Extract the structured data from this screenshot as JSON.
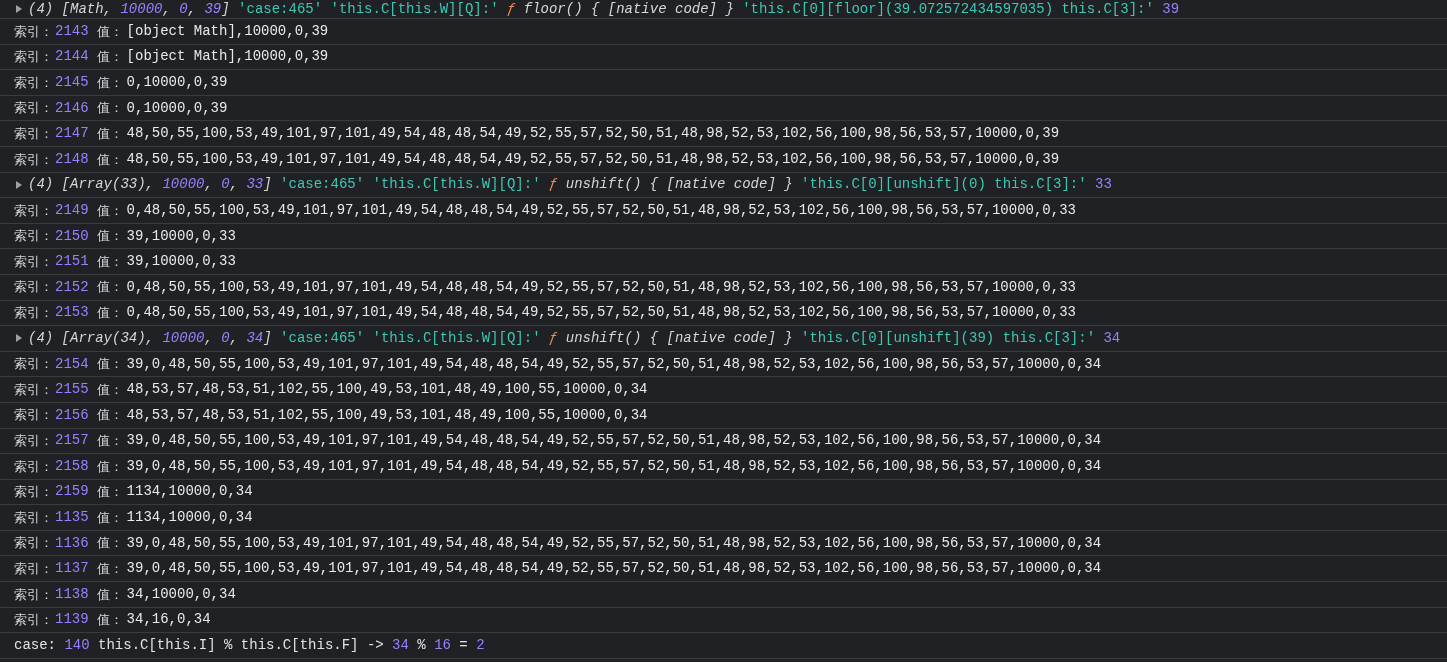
{
  "console": {
    "messages": [
      {
        "kind": "object",
        "expanded": false,
        "tokens": [
          {
            "kind": "preview",
            "text": "(4) [Math, "
          },
          {
            "kind": "preview_number",
            "text": "10000"
          },
          {
            "kind": "preview",
            "text": ", "
          },
          {
            "kind": "preview_number",
            "text": "0"
          },
          {
            "kind": "preview",
            "text": ", "
          },
          {
            "kind": "preview_number",
            "text": "39"
          },
          {
            "kind": "preview",
            "text": "]"
          },
          {
            "kind": "string",
            "text": " 'case:465' 'this.C[this.W][Q]:' "
          },
          {
            "kind": "function_sign",
            "text": "ƒ "
          },
          {
            "kind": "preview",
            "text": "floor() { [native code] }"
          },
          {
            "kind": "string",
            "text": " 'this.C[0][floor](39.072572434597035) this.C[3]:' "
          },
          {
            "kind": "number",
            "text": "39"
          }
        ]
      },
      {
        "kind": "index",
        "label": "索引：",
        "index": "2143",
        "value_label": "值：",
        "value": "[object Math],10000,0,39"
      },
      {
        "kind": "index",
        "label": "索引：",
        "index": "2144",
        "value_label": "值：",
        "value": "[object Math],10000,0,39"
      },
      {
        "kind": "index",
        "label": "索引：",
        "index": "2145",
        "value_label": "值：",
        "value": "0,10000,0,39"
      },
      {
        "kind": "index",
        "label": "索引：",
        "index": "2146",
        "value_label": "值：",
        "value": "0,10000,0,39"
      },
      {
        "kind": "index",
        "label": "索引：",
        "index": "2147",
        "value_label": "值：",
        "value": "48,50,55,100,53,49,101,97,101,49,54,48,48,54,49,52,55,57,52,50,51,48,98,52,53,102,56,100,98,56,53,57,10000,0,39"
      },
      {
        "kind": "index",
        "label": "索引：",
        "index": "2148",
        "value_label": "值：",
        "value": "48,50,55,100,53,49,101,97,101,49,54,48,48,54,49,52,55,57,52,50,51,48,98,52,53,102,56,100,98,56,53,57,10000,0,39"
      },
      {
        "kind": "object",
        "expanded": false,
        "tokens": [
          {
            "kind": "preview",
            "text": "(4) [Array(33), "
          },
          {
            "kind": "preview_number",
            "text": "10000"
          },
          {
            "kind": "preview",
            "text": ", "
          },
          {
            "kind": "preview_number",
            "text": "0"
          },
          {
            "kind": "preview",
            "text": ", "
          },
          {
            "kind": "preview_number",
            "text": "33"
          },
          {
            "kind": "preview",
            "text": "]"
          },
          {
            "kind": "string",
            "text": " 'case:465' 'this.C[this.W][Q]:' "
          },
          {
            "kind": "function_sign",
            "text": "ƒ "
          },
          {
            "kind": "preview",
            "text": "unshift() { [native code] }"
          },
          {
            "kind": "string",
            "text": " 'this.C[0][unshift](0) this.C[3]:' "
          },
          {
            "kind": "number",
            "text": "33"
          }
        ]
      },
      {
        "kind": "index",
        "label": "索引：",
        "index": "2149",
        "value_label": "值：",
        "value": "0,48,50,55,100,53,49,101,97,101,49,54,48,48,54,49,52,55,57,52,50,51,48,98,52,53,102,56,100,98,56,53,57,10000,0,33"
      },
      {
        "kind": "index",
        "label": "索引：",
        "index": "2150",
        "value_label": "值：",
        "value": "39,10000,0,33"
      },
      {
        "kind": "index",
        "label": "索引：",
        "index": "2151",
        "value_label": "值：",
        "value": "39,10000,0,33"
      },
      {
        "kind": "index",
        "label": "索引：",
        "index": "2152",
        "value_label": "值：",
        "value": "0,48,50,55,100,53,49,101,97,101,49,54,48,48,54,49,52,55,57,52,50,51,48,98,52,53,102,56,100,98,56,53,57,10000,0,33"
      },
      {
        "kind": "index",
        "label": "索引：",
        "index": "2153",
        "value_label": "值：",
        "value": "0,48,50,55,100,53,49,101,97,101,49,54,48,48,54,49,52,55,57,52,50,51,48,98,52,53,102,56,100,98,56,53,57,10000,0,33"
      },
      {
        "kind": "object",
        "expanded": false,
        "tokens": [
          {
            "kind": "preview",
            "text": "(4) [Array(34), "
          },
          {
            "kind": "preview_number",
            "text": "10000"
          },
          {
            "kind": "preview",
            "text": ", "
          },
          {
            "kind": "preview_number",
            "text": "0"
          },
          {
            "kind": "preview",
            "text": ", "
          },
          {
            "kind": "preview_number",
            "text": "34"
          },
          {
            "kind": "preview",
            "text": "]"
          },
          {
            "kind": "string",
            "text": " 'case:465' 'this.C[this.W][Q]:' "
          },
          {
            "kind": "function_sign",
            "text": "ƒ "
          },
          {
            "kind": "preview",
            "text": "unshift() { [native code] }"
          },
          {
            "kind": "string",
            "text": " 'this.C[0][unshift](39) this.C[3]:' "
          },
          {
            "kind": "number",
            "text": "34"
          }
        ]
      },
      {
        "kind": "index",
        "label": "索引：",
        "index": "2154",
        "value_label": "值：",
        "value": "39,0,48,50,55,100,53,49,101,97,101,49,54,48,48,54,49,52,55,57,52,50,51,48,98,52,53,102,56,100,98,56,53,57,10000,0,34"
      },
      {
        "kind": "index",
        "label": "索引：",
        "index": "2155",
        "value_label": "值：",
        "value": "48,53,57,48,53,51,102,55,100,49,53,101,48,49,100,55,10000,0,34"
      },
      {
        "kind": "index",
        "label": "索引：",
        "index": "2156",
        "value_label": "值：",
        "value": "48,53,57,48,53,51,102,55,100,49,53,101,48,49,100,55,10000,0,34"
      },
      {
        "kind": "index",
        "label": "索引：",
        "index": "2157",
        "value_label": "值：",
        "value": "39,0,48,50,55,100,53,49,101,97,101,49,54,48,48,54,49,52,55,57,52,50,51,48,98,52,53,102,56,100,98,56,53,57,10000,0,34"
      },
      {
        "kind": "index",
        "label": "索引：",
        "index": "2158",
        "value_label": "值：",
        "value": "39,0,48,50,55,100,53,49,101,97,101,49,54,48,48,54,49,52,55,57,52,50,51,48,98,52,53,102,56,100,98,56,53,57,10000,0,34"
      },
      {
        "kind": "index",
        "label": "索引：",
        "index": "2159",
        "value_label": "值：",
        "value": "1134,10000,0,34"
      },
      {
        "kind": "index",
        "label": "索引：",
        "index": "1135",
        "value_label": "值：",
        "value": "1134,10000,0,34"
      },
      {
        "kind": "index",
        "label": "索引：",
        "index": "1136",
        "value_label": "值：",
        "value": "39,0,48,50,55,100,53,49,101,97,101,49,54,48,48,54,49,52,55,57,52,50,51,48,98,52,53,102,56,100,98,56,53,57,10000,0,34"
      },
      {
        "kind": "index",
        "label": "索引：",
        "index": "1137",
        "value_label": "值：",
        "value": "39,0,48,50,55,100,53,49,101,97,101,49,54,48,48,54,49,52,55,57,52,50,51,48,98,52,53,102,56,100,98,56,53,57,10000,0,34"
      },
      {
        "kind": "index",
        "label": "索引：",
        "index": "1138",
        "value_label": "值：",
        "value": "34,10000,0,34"
      },
      {
        "kind": "index",
        "label": "索引：",
        "index": "1139",
        "value_label": "值：",
        "value": "34,16,0,34"
      },
      {
        "kind": "text",
        "tokens": [
          {
            "kind": "plain",
            "text": "case: "
          },
          {
            "kind": "number",
            "text": "140"
          },
          {
            "kind": "plain",
            "text": " this.C[this.I] % this.C[this.F] -> "
          },
          {
            "kind": "number",
            "text": "34"
          },
          {
            "kind": "plain",
            "text": " % "
          },
          {
            "kind": "number",
            "text": "16"
          },
          {
            "kind": "plain",
            "text": " = "
          },
          {
            "kind": "number",
            "text": "2"
          }
        ]
      }
    ]
  }
}
